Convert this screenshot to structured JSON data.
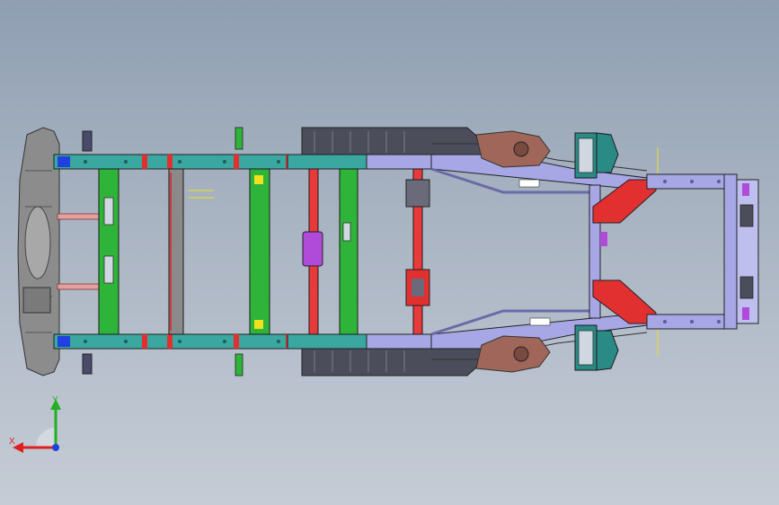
{
  "triad": {
    "x_label": "X",
    "y_label": "Y",
    "x_color": "#e02020",
    "y_color": "#20b020",
    "z_color": "#2040e0"
  },
  "colors": {
    "background_top": "#8f9fb2",
    "background_bottom": "#c5ccd6",
    "rail_teal": "#3aa7a0",
    "crossmember_green": "#2fb43a",
    "rear_frame_lavender": "#a7a7e6",
    "crossmember_red": "#e83a3a",
    "bracket_red": "#e23030",
    "bumper_grey": "#8c8c8c",
    "fuel_tank_dark": "#4b4e5a",
    "spring_hanger_brown": "#a0665a",
    "mount_purple": "#b04ad8",
    "tail_teal": "#2a8a86",
    "yellow_marker": "#f0e020"
  }
}
